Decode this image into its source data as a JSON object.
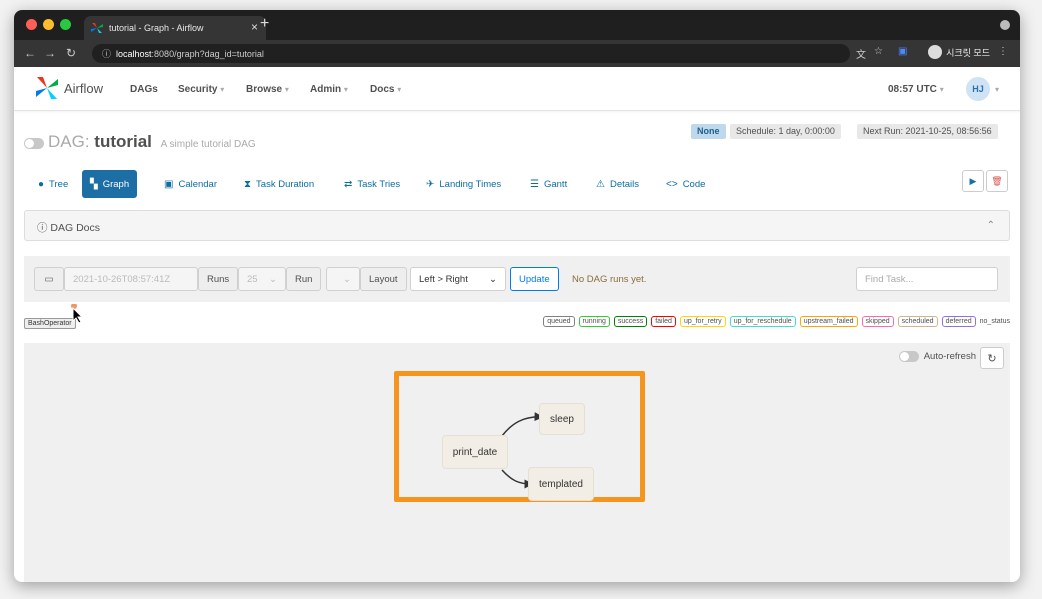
{
  "browser": {
    "tab_title": "tutorial - Graph - Airflow",
    "url_host": "localhost",
    "url_rest": ":8080/graph?dag_id=tutorial",
    "profile_label": "시크릿 모드",
    "traffic_colors": [
      "#ff5f57",
      "#febc2e",
      "#28c840"
    ]
  },
  "nav": {
    "brand": "Airflow",
    "menu": [
      {
        "label": "DAGs",
        "dropdown": false
      },
      {
        "label": "Security",
        "dropdown": true
      },
      {
        "label": "Browse",
        "dropdown": true
      },
      {
        "label": "Admin",
        "dropdown": true
      },
      {
        "label": "Docs",
        "dropdown": true
      }
    ],
    "clock": "08:57 UTC",
    "user_initials": "HJ"
  },
  "dag": {
    "prefix": "DAG:",
    "name": "tutorial",
    "description": "A simple tutorial DAG",
    "badge_none": "None",
    "schedule": "Schedule: 1 day, 0:00:00",
    "next_run": "Next Run: 2021-10-25, 08:56:56"
  },
  "views": [
    {
      "label": "Tree",
      "icon": "tree-icon",
      "active": false
    },
    {
      "label": "Graph",
      "icon": "graph-icon",
      "active": true
    },
    {
      "label": "Calendar",
      "icon": "calendar-icon",
      "active": false
    },
    {
      "label": "Task Duration",
      "icon": "hourglass-icon",
      "active": false
    },
    {
      "label": "Task Tries",
      "icon": "retry-icon",
      "active": false
    },
    {
      "label": "Landing Times",
      "icon": "plane-icon",
      "active": false
    },
    {
      "label": "Gantt",
      "icon": "gantt-icon",
      "active": false
    },
    {
      "label": "Details",
      "icon": "warning-icon",
      "active": false
    },
    {
      "label": "Code",
      "icon": "code-icon",
      "active": false
    }
  ],
  "docs": {
    "label": "DAG Docs"
  },
  "controls": {
    "date_value": "2021-10-26T08:57:41Z",
    "runs_label": "Runs",
    "runs_value": "25",
    "run_label": "Run",
    "layout_label": "Layout",
    "layout_value": "Left > Right",
    "update_label": "Update",
    "status_text": "No DAG runs yet.",
    "find_placeholder": "Find Task..."
  },
  "operator_badge": "BashOperator",
  "legend": [
    {
      "label": "queued",
      "color": "#808080"
    },
    {
      "label": "running",
      "color": "#32cd32"
    },
    {
      "label": "success",
      "color": "#008000"
    },
    {
      "label": "failed",
      "color": "#ff0000"
    },
    {
      "label": "up_for_retry",
      "color": "#ffd700"
    },
    {
      "label": "up_for_reschedule",
      "color": "#40e0d0"
    },
    {
      "label": "upstream_failed",
      "color": "#ffa500"
    },
    {
      "label": "skipped",
      "color": "#ff69b4"
    },
    {
      "label": "scheduled",
      "color": "#d2b48c"
    },
    {
      "label": "deferred",
      "color": "#9370db"
    }
  ],
  "legend_last": "no_status",
  "graph": {
    "auto_refresh_label": "Auto-refresh",
    "highlight_color": "#f5951e",
    "tasks": [
      "print_date",
      "sleep",
      "templated"
    ]
  }
}
